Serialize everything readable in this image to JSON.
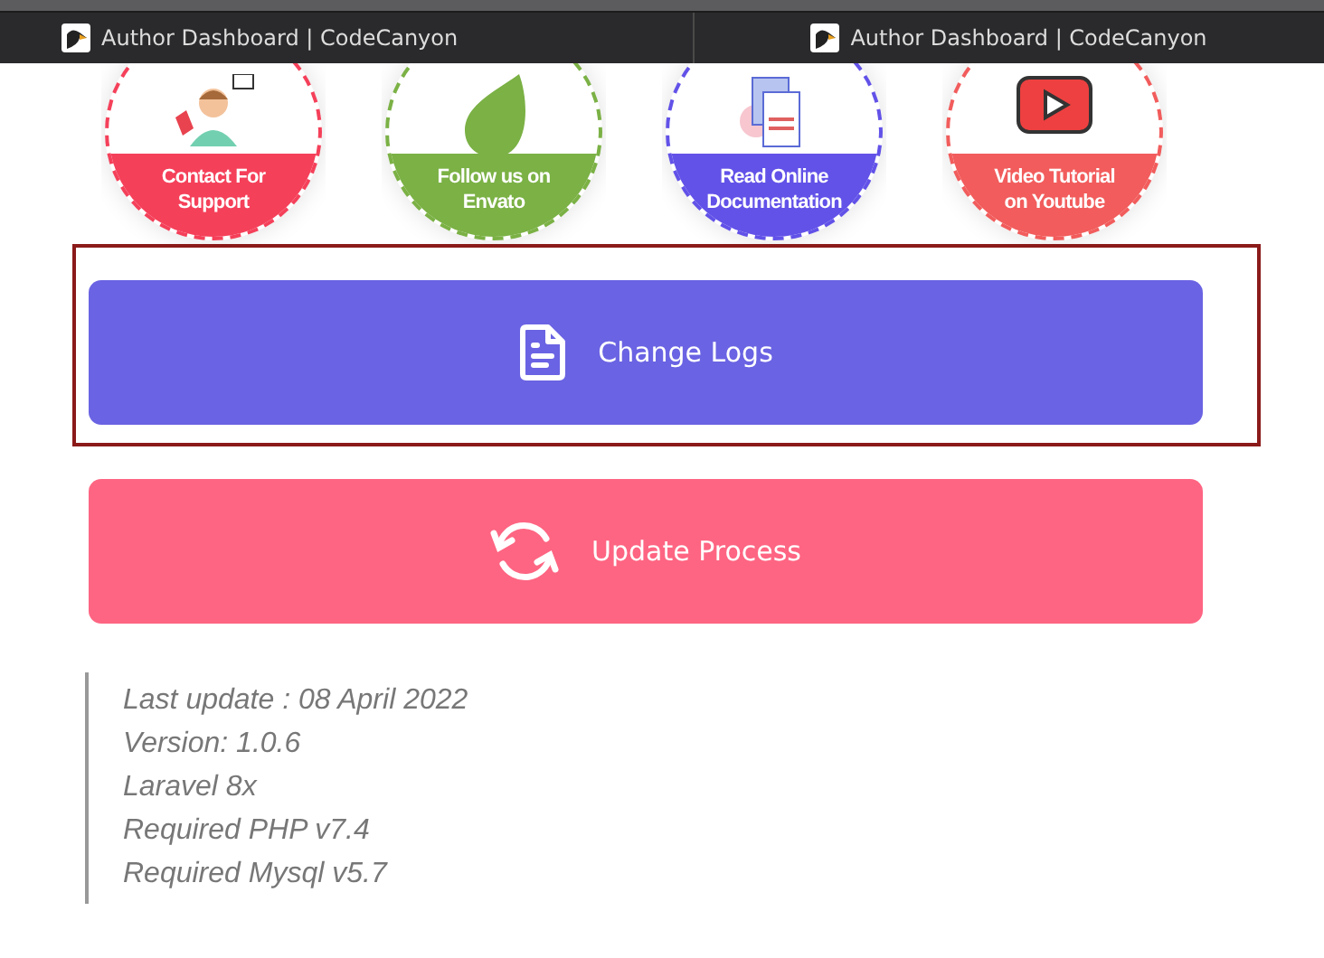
{
  "browser_tabs": [
    {
      "title": "Author Dashboard | CodeCanyon",
      "selected": false
    },
    {
      "title": "Author Dashboard | CodeCanyon",
      "selected": false
    }
  ],
  "badges": [
    {
      "kind": "support",
      "color": "#f5405a",
      "lines": [
        "Contact For",
        "Support"
      ]
    },
    {
      "kind": "envato",
      "color": "#7bb145",
      "lines": [
        "Follow us on",
        "Envato"
      ]
    },
    {
      "kind": "docs",
      "color": "#6252e8",
      "lines": [
        "Read Online",
        "Documentation"
      ]
    },
    {
      "kind": "video",
      "color": "#f25c5c",
      "lines": [
        "Video Tutorial",
        "on Youtube"
      ]
    }
  ],
  "buttons": [
    {
      "kind": "changelog",
      "label": "Change Logs",
      "color": "#6a63e3",
      "focused": true
    },
    {
      "kind": "update",
      "label": "Update Process",
      "color": "#fe6582",
      "focused": false
    }
  ],
  "notes": [
    "Last update : 08 April 2022",
    "Version: 1.0.6",
    "Laravel 8x",
    "Required PHP v7.4",
    "Required Mysql v5.7"
  ]
}
